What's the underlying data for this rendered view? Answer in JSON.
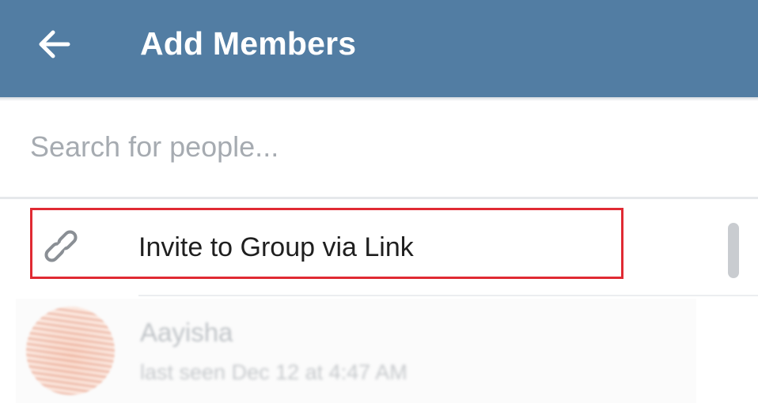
{
  "header": {
    "title": "Add Members",
    "back_icon": "arrow-left-icon",
    "background_color": "#527da3",
    "title_color": "#ffffff"
  },
  "search": {
    "placeholder": "Search for people...",
    "value": ""
  },
  "invite_link": {
    "label": "Invite to Group via Link",
    "icon": "link-icon",
    "highlight_color": "#e02a33"
  },
  "contacts": [
    {
      "name": "Aayisha",
      "status": "last seen Dec 12 at 4:47 AM"
    }
  ]
}
